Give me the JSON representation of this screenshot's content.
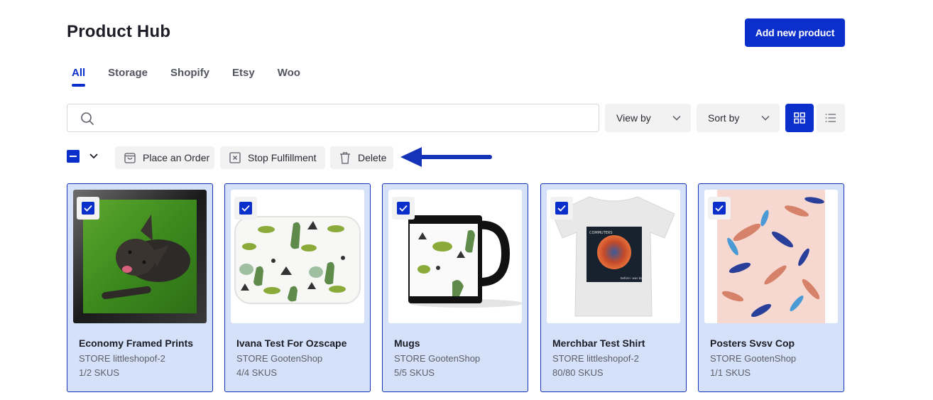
{
  "header": {
    "title": "Product Hub",
    "add_button": "Add new product"
  },
  "tabs": [
    {
      "label": "All",
      "active": true
    },
    {
      "label": "Storage",
      "active": false
    },
    {
      "label": "Shopify",
      "active": false
    },
    {
      "label": "Etsy",
      "active": false
    },
    {
      "label": "Woo",
      "active": false
    }
  ],
  "search": {
    "value": "",
    "placeholder": "",
    "icon": "search-icon"
  },
  "filters": {
    "view_by": "View by",
    "sort_by": "Sort by",
    "grid_view_active": true
  },
  "bulk_actions": {
    "select_state": "partial",
    "place_order": "Place an Order",
    "stop_fulfillment": "Stop Fulfillment",
    "delete": "Delete"
  },
  "annotation": {
    "type": "arrow",
    "points_to": "delete",
    "color": "#1433b8"
  },
  "colors": {
    "accent": "#0a2fcb",
    "card_selected_bg": "#d4e1f8",
    "card_selected_border": "#1433b8",
    "button_bg": "#f2f2f3"
  },
  "products": [
    {
      "name": "Economy Framed Prints",
      "store": "STORE littleshopof-2",
      "skus": "1/2 SKUS",
      "selected": true,
      "image": "framed print of french bulldog on grass"
    },
    {
      "name": "Ivana Test For Ozscape",
      "store": "STORE GootenShop",
      "skus": "4/4 SKUS",
      "selected": true,
      "image": "bath mat with dinosaur pattern"
    },
    {
      "name": "Mugs",
      "store": "STORE GootenShop",
      "skus": "5/5 SKUS",
      "selected": true,
      "image": "black mug with dinosaur pattern"
    },
    {
      "name": "Merchbar Test Shirt",
      "store": "STORE littleshopof-2",
      "skus": "80/80 SKUS",
      "selected": true,
      "image": "white t-shirt with The Commuters album art"
    },
    {
      "name": "Posters Svsv Cop",
      "store": "STORE GootenShop",
      "skus": "1/1 SKUS",
      "selected": true,
      "image": "poster with leaf pattern"
    }
  ]
}
